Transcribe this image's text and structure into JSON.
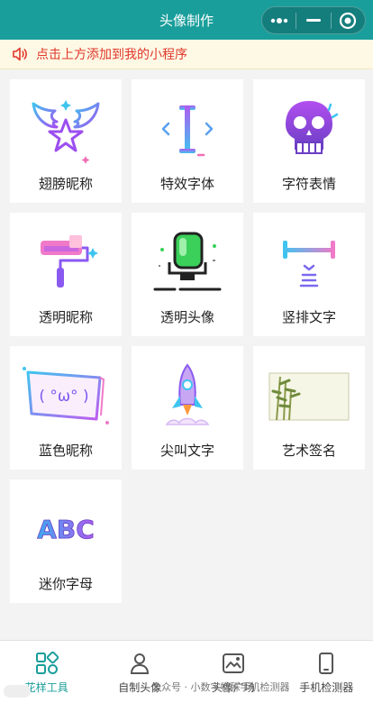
{
  "header": {
    "title": "头像制作"
  },
  "notice": {
    "text": "点击上方添加到我的小程序"
  },
  "tools": [
    {
      "label": "翅膀昵称",
      "icon": "wings-star-icon"
    },
    {
      "label": "特效字体",
      "icon": "text-cursor-icon"
    },
    {
      "label": "字符表情",
      "icon": "skull-icon"
    },
    {
      "label": "透明昵称",
      "icon": "paint-roller-icon"
    },
    {
      "label": "透明头像",
      "icon": "green-avatar-icon"
    },
    {
      "label": "竖排文字",
      "icon": "vertical-text-icon"
    },
    {
      "label": "蓝色昵称",
      "icon": "kaomoji-card-icon"
    },
    {
      "label": "尖叫文字",
      "icon": "rocket-icon"
    },
    {
      "label": "艺术签名",
      "icon": "bamboo-painting-icon"
    },
    {
      "label": "迷你字母",
      "icon": "abc-letters-icon"
    }
  ],
  "kaomoji": "( °ω° )",
  "abc": "ABC",
  "tabbar": [
    {
      "label": "花样工具",
      "active": true
    },
    {
      "label": "自制头像",
      "active": false
    },
    {
      "label": "头像广场",
      "active": false
    },
    {
      "label": "手机检测器",
      "active": false
    }
  ],
  "watermark": "公众号 · 小数字特殊手机检测器",
  "colors": {
    "brand": "#1a9e9b",
    "notice_text": "#e0372c",
    "notice_bg": "#fef9e4"
  }
}
